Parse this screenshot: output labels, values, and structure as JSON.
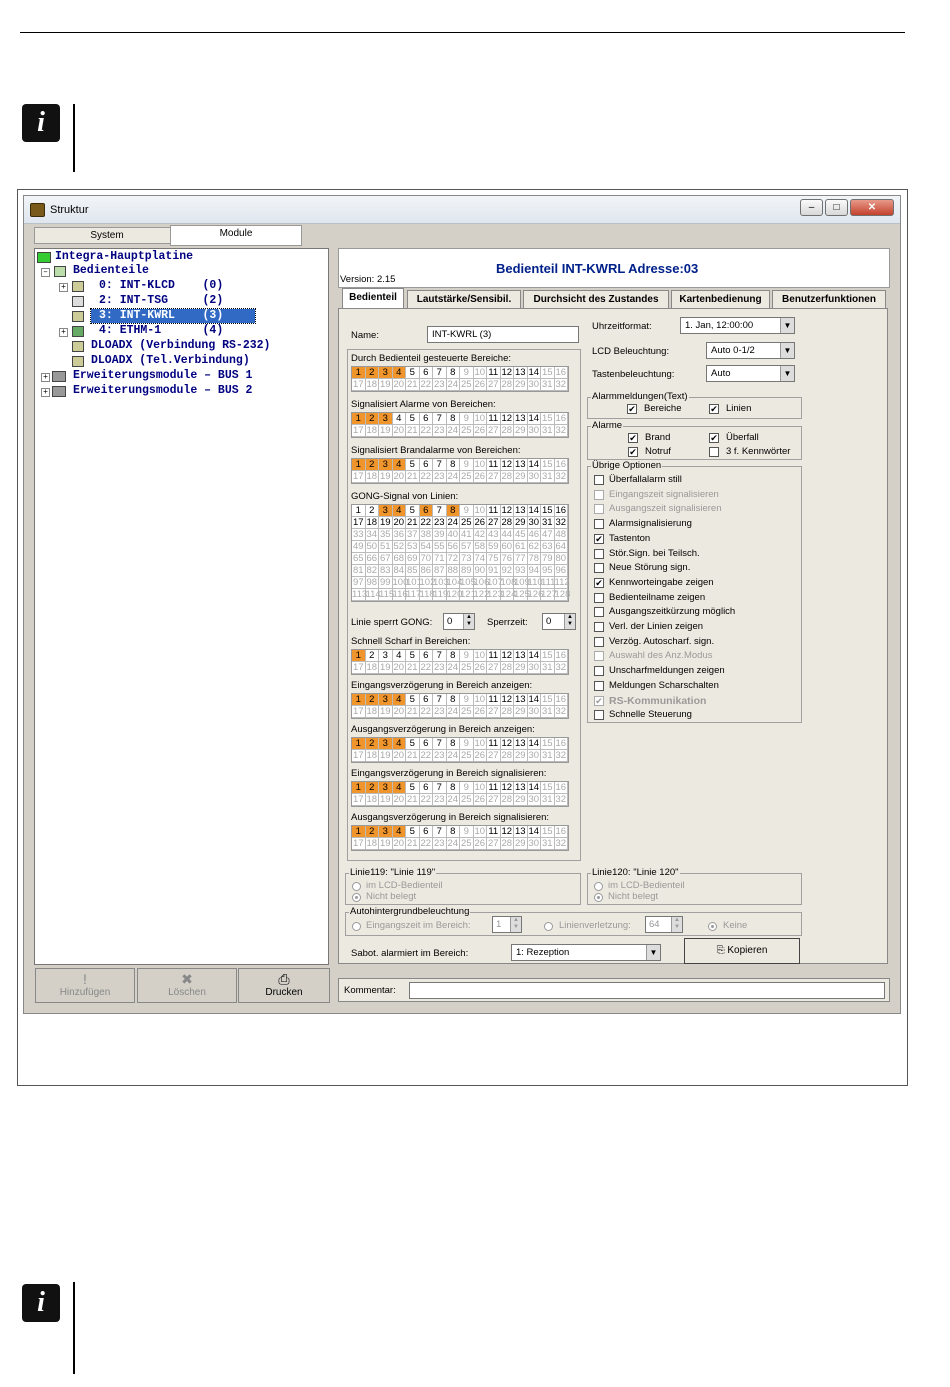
{
  "window": {
    "title": "Struktur",
    "min": "–",
    "max": "□",
    "close": "✕"
  },
  "tabs": {
    "system": "System",
    "module": "Module"
  },
  "tree": {
    "root": "Integra-Hauptplatine",
    "bedienteile": "Bedienteile",
    "items": [
      {
        "label": "0: INT-KLCD    (0)"
      },
      {
        "label": "2: INT-TSG     (2)"
      },
      {
        "label": "3: INT-KWRL    (3)"
      },
      {
        "label": "4: ETHM-1      (4)"
      }
    ],
    "dload1": "DLOADX (Verbindung RS-232)",
    "dload2": "DLOADX (Tel.Verbindung)",
    "bus1": "Erweiterungsmodule – BUS 1",
    "bus2": "Erweiterungsmodule – BUS 2"
  },
  "leftButtons": {
    "add": "Hinzufügen",
    "delete": "Löschen",
    "print": "Drucken"
  },
  "header": {
    "title": "Bedienteil INT-KWRL Adresse:03",
    "version": "Version: 2.15"
  },
  "subtabs": [
    "Bedienteil",
    "Lautstärke/Sensibil.",
    "Durchsicht des Zustandes",
    "Kartenbedienung",
    "Benutzerfunktionen"
  ],
  "name": {
    "label": "Name:",
    "value": "INT-KWRL   (3)"
  },
  "areaGrids": [
    {
      "label": "Durch Bedienteil gesteuerte Bereiche:",
      "on": [
        1,
        2,
        3,
        4
      ]
    },
    {
      "label": "Signalisiert Alarme von Bereichen:",
      "on": [
        1,
        2,
        3
      ]
    },
    {
      "label": "Signalisiert Brandalarme von Bereichen:",
      "on": [
        1,
        2,
        3,
        4
      ]
    }
  ],
  "gong": {
    "label": "GONG-Signal von Linien:",
    "on": [
      3,
      4,
      6,
      8
    ],
    "linieLabel": "Linie sperrt GONG:",
    "linieVal": "0",
    "sperrLabel": "Sperrzeit:",
    "sperrVal": "0"
  },
  "areaGrids2": [
    {
      "label": "Schnell Scharf in Bereichen:",
      "on": [
        1
      ]
    },
    {
      "label": "Eingangsverzögerung in Bereich anzeigen:",
      "on": [
        1,
        2,
        3,
        4
      ]
    },
    {
      "label": "Ausgangsverzögerung in Bereich anzeigen:",
      "on": [
        1,
        2,
        3,
        4
      ]
    },
    {
      "label": "Eingangsverzögerung in Bereich signalisieren:",
      "on": [
        1,
        2,
        3,
        4
      ]
    },
    {
      "label": "Ausgangsverzögerung in Bereich signalisieren:",
      "on": [
        1,
        2,
        3,
        4
      ]
    }
  ],
  "right": {
    "uhrLabel": "Uhrzeitformat:",
    "uhrVal": "1. Jan, 12:00:00",
    "lcdLabel": "LCD Beleuchtung:",
    "lcdVal": "Auto 0-1/2",
    "tastLabel": "Tastenbeleuchtung:",
    "tastVal": "Auto",
    "alarmText": "Alarmmeldungen(Text)",
    "bereiche": "Bereiche",
    "linien": "Linien",
    "alarme": "Alarme",
    "brand": "Brand",
    "ueberfall": "Überfall",
    "notruf": "Notruf",
    "kennw": "3 f. Kennwörter",
    "uebrige": "Übrige Optionen"
  },
  "options": [
    {
      "label": "Überfallalarm still",
      "checked": false,
      "enabled": true
    },
    {
      "label": "Eingangszeit signalisieren",
      "checked": false,
      "enabled": false
    },
    {
      "label": "Ausgangszeit signalisieren",
      "checked": false,
      "enabled": false
    },
    {
      "label": "Alarmsignalisierung",
      "checked": false,
      "enabled": true
    },
    {
      "label": "Tastenton",
      "checked": true,
      "enabled": true
    },
    {
      "label": "Stör.Sign. bei Teilsch.",
      "checked": false,
      "enabled": true
    },
    {
      "label": "Neue Störung sign.",
      "checked": false,
      "enabled": true
    },
    {
      "label": "Kennworteingabe zeigen",
      "checked": true,
      "enabled": true
    },
    {
      "label": "Bedienteilname zeigen",
      "checked": false,
      "enabled": true
    },
    {
      "label": "Ausgangszeitkürzung möglich",
      "checked": false,
      "enabled": true
    },
    {
      "label": "Verl. der Linien zeigen",
      "checked": false,
      "enabled": true
    },
    {
      "label": "Verzög. Autoscharf. sign.",
      "checked": false,
      "enabled": true
    },
    {
      "label": "Auswahl des Anz.Modus",
      "checked": false,
      "enabled": false
    },
    {
      "label": "Unscharfmeldungen zeigen",
      "checked": false,
      "enabled": true
    },
    {
      "label": "Meldungen Scharschalten",
      "checked": false,
      "enabled": true
    },
    {
      "label": "RS-Kommunikation",
      "checked": true,
      "enabled": false
    },
    {
      "label": "Schnelle Steuerung",
      "checked": false,
      "enabled": true
    }
  ],
  "bottom": {
    "l119": "Linie119: \"Linie 119\"",
    "l120": "Linie120: \"Linie 120\"",
    "imLCD": "im LCD-Bedienteil",
    "nicht": "Nicht belegt",
    "auto": "Autohintergrundbeleuchtung",
    "eingang": "Eingangszeit im Bereich:",
    "eingangVal": "1",
    "linVerl": "Linienverletzung:",
    "linVal": "64",
    "keine": "Keine",
    "sabot": "Sabot. alarmiert im Bereich:",
    "sabotVal": "1: Rezeption",
    "kopieren": "Kopieren",
    "kommentar": "Kommentar:"
  },
  "colors": {
    "accent": "#f0952c",
    "headerText": "#00208a",
    "tree": "#000080"
  }
}
